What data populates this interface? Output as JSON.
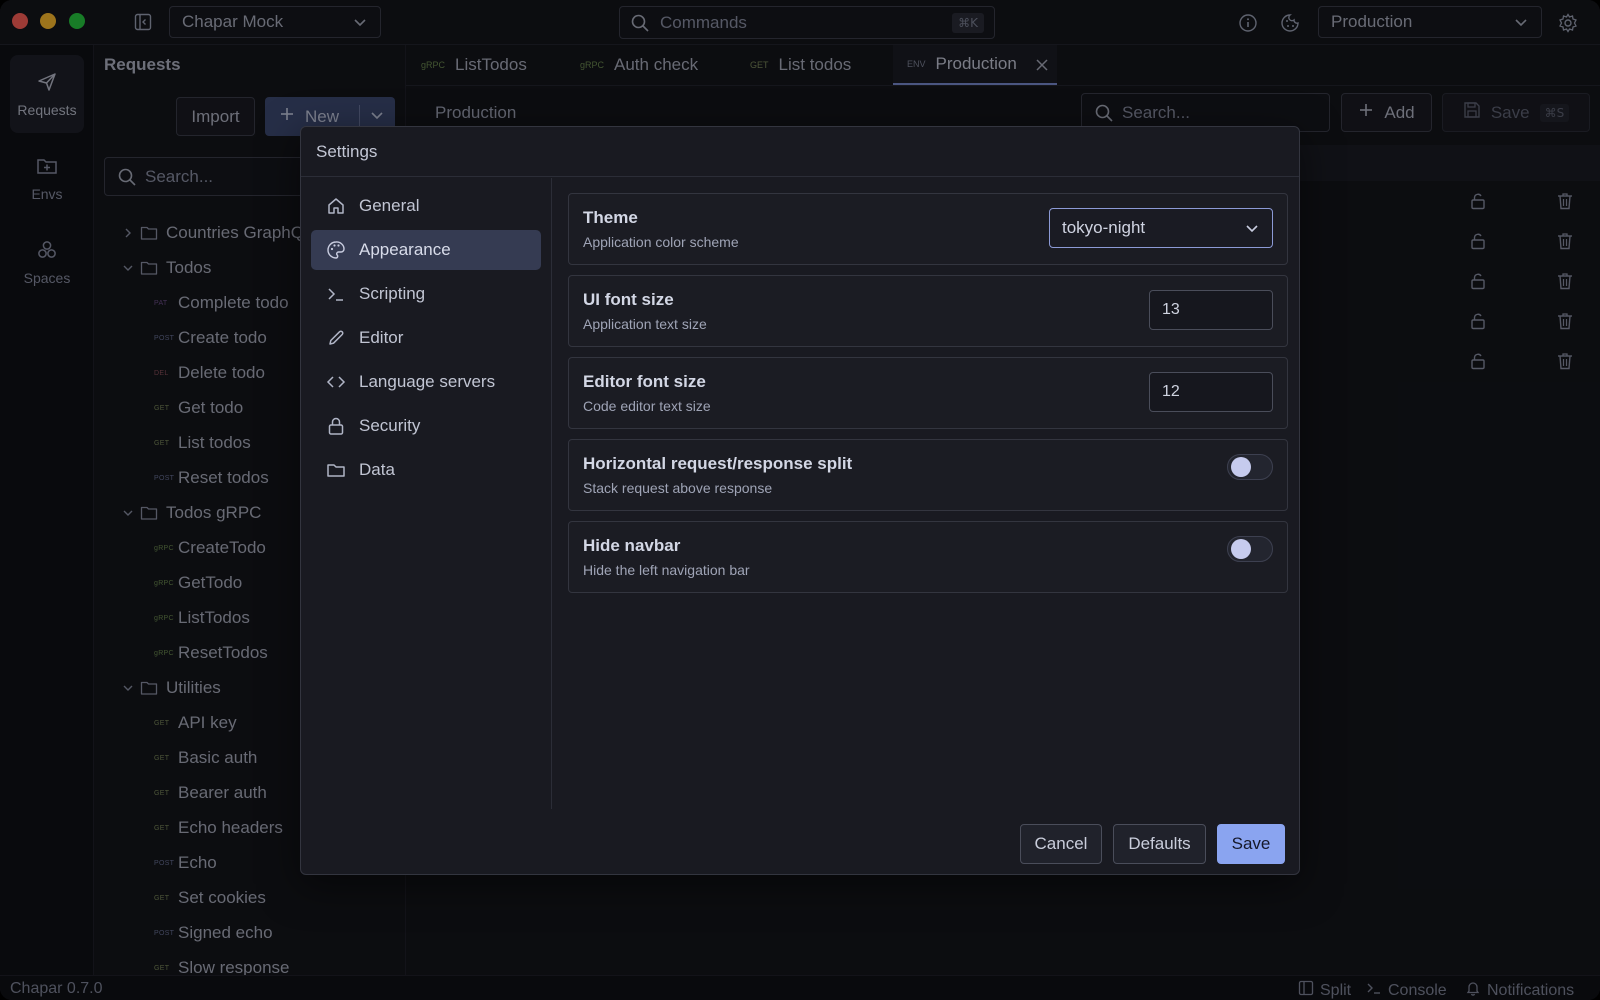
{
  "app": {
    "workspace": "Chapar Mock",
    "commands_placeholder": "Commands",
    "commands_shortcut": "⌘K",
    "environment": "Production",
    "version": "Chapar 0.7.0"
  },
  "rail": {
    "items": [
      {
        "label": "Requests",
        "icon": "send-icon"
      },
      {
        "label": "Envs",
        "icon": "folder-plus-icon"
      },
      {
        "label": "Spaces",
        "icon": "boxes-icon"
      }
    ]
  },
  "requests": {
    "title": "Requests",
    "import_label": "Import",
    "new_label": "New",
    "search_placeholder": "Search...",
    "tree": [
      {
        "type": "folder",
        "label": "Countries GraphQL",
        "open": false
      },
      {
        "type": "folder",
        "label": "Todos",
        "open": true
      },
      {
        "type": "item",
        "method": "PAT",
        "label": "Complete todo"
      },
      {
        "type": "item",
        "method": "POST",
        "label": "Create todo"
      },
      {
        "type": "item",
        "method": "DEL",
        "label": "Delete todo"
      },
      {
        "type": "item",
        "method": "GET",
        "label": "Get todo"
      },
      {
        "type": "item",
        "method": "GET",
        "label": "List todos"
      },
      {
        "type": "item",
        "method": "POST",
        "label": "Reset todos"
      },
      {
        "type": "folder",
        "label": "Todos gRPC",
        "open": true
      },
      {
        "type": "item",
        "method": "gRPC",
        "label": "CreateTodo"
      },
      {
        "type": "item",
        "method": "gRPC",
        "label": "GetTodo"
      },
      {
        "type": "item",
        "method": "gRPC",
        "label": "ListTodos"
      },
      {
        "type": "item",
        "method": "gRPC",
        "label": "ResetTodos"
      },
      {
        "type": "folder",
        "label": "Utilities",
        "open": true
      },
      {
        "type": "item",
        "method": "GET",
        "label": "API key"
      },
      {
        "type": "item",
        "method": "GET",
        "label": "Basic auth"
      },
      {
        "type": "item",
        "method": "GET",
        "label": "Bearer auth"
      },
      {
        "type": "item",
        "method": "GET",
        "label": "Echo headers"
      },
      {
        "type": "item",
        "method": "POST",
        "label": "Echo"
      },
      {
        "type": "item",
        "method": "GET",
        "label": "Set cookies"
      },
      {
        "type": "item",
        "method": "POST",
        "label": "Signed echo"
      },
      {
        "type": "item",
        "method": "GET",
        "label": "Slow response"
      }
    ]
  },
  "tabs": [
    {
      "tag": "gRPC",
      "label": "ListTodos"
    },
    {
      "tag": "gRPC",
      "label": "Auth check"
    },
    {
      "tag": "GET",
      "label": "List todos"
    },
    {
      "tag": "ENV",
      "label": "Production",
      "active": true
    }
  ],
  "env_editor": {
    "name": "Production",
    "search_placeholder": "Search...",
    "add_label": "Add",
    "save_label": "Save",
    "save_shortcut": "⌘S"
  },
  "settings": {
    "title": "Settings",
    "nav": [
      {
        "label": "General",
        "icon": "home-icon"
      },
      {
        "label": "Appearance",
        "icon": "palette-icon",
        "active": true
      },
      {
        "label": "Scripting",
        "icon": "terminal-icon"
      },
      {
        "label": "Editor",
        "icon": "pencil-icon"
      },
      {
        "label": "Language servers",
        "icon": "code-icon"
      },
      {
        "label": "Security",
        "icon": "lock-icon"
      },
      {
        "label": "Data",
        "icon": "folder-icon"
      }
    ],
    "theme": {
      "title": "Theme",
      "desc": "Application color scheme",
      "value": "tokyo-night"
    },
    "ui_font": {
      "title": "UI font size",
      "desc": "Application text size",
      "value": "13"
    },
    "editor_font": {
      "title": "Editor font size",
      "desc": "Code editor text size",
      "value": "12"
    },
    "split": {
      "title": "Horizontal request/response split",
      "desc": "Stack request above response",
      "enabled": false
    },
    "hide_navbar": {
      "title": "Hide navbar",
      "desc": "Hide the left navigation bar",
      "enabled": false
    },
    "cancel_label": "Cancel",
    "defaults_label": "Defaults",
    "save_label": "Save"
  },
  "statusbar": {
    "split_label": "Split",
    "console_label": "Console",
    "notifications_label": "Notifications"
  },
  "colors": {
    "accent": "#8aa4f0",
    "active_nav": "#353b52",
    "new_button": "#3e4b73"
  }
}
